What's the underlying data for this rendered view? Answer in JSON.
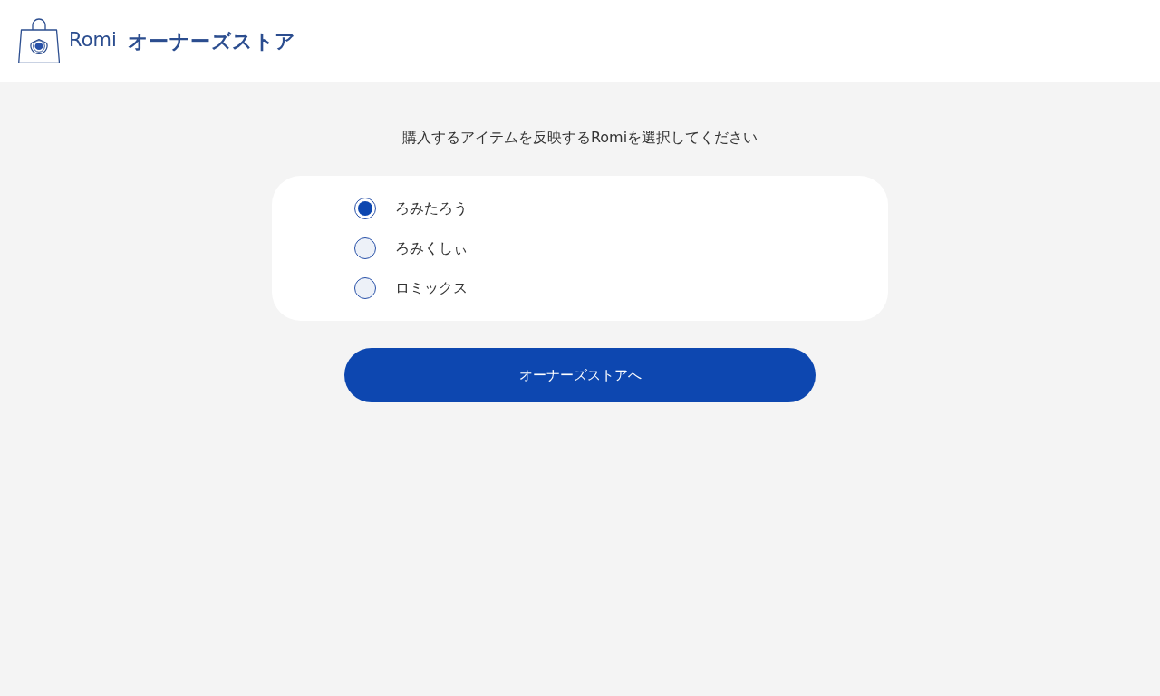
{
  "header": {
    "brand": "Romi",
    "store_name": "オーナーズストア"
  },
  "prompt": "購入するアイテムを反映するRomiを選択してください",
  "options": [
    {
      "label": "ろみたろう",
      "selected": true
    },
    {
      "label": "ろみくしぃ",
      "selected": false
    },
    {
      "label": "ロミックス",
      "selected": false
    }
  ],
  "button": {
    "label": "オーナーズストアへ"
  }
}
